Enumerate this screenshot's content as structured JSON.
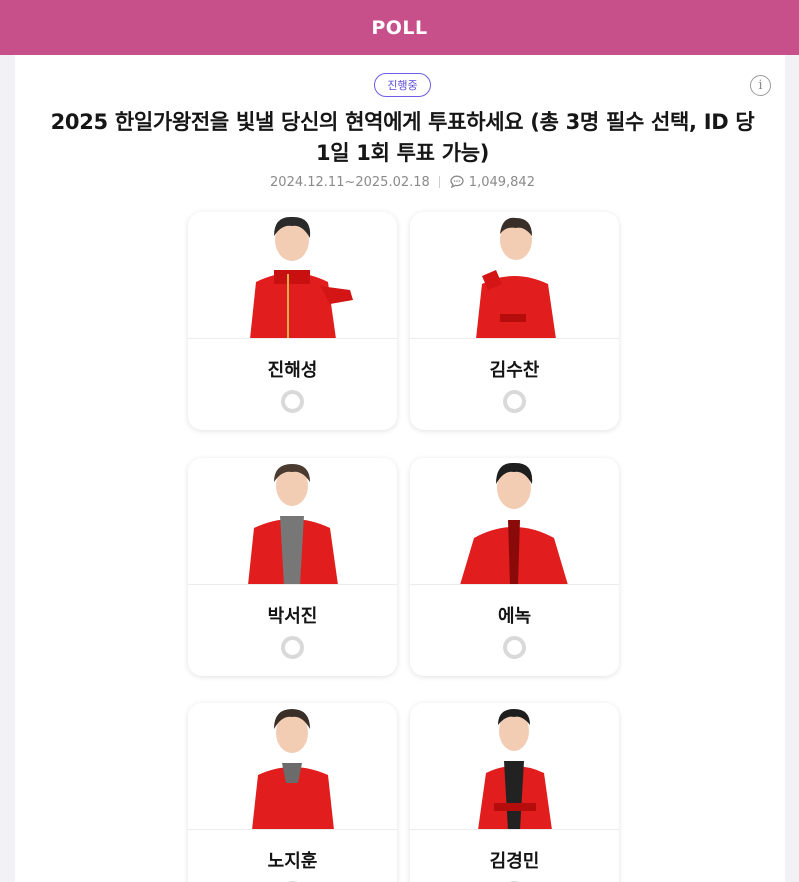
{
  "header": {
    "title": "POLL"
  },
  "poll": {
    "status_badge": "진행중",
    "title": "2025 한일가왕전을 빛낼 당신의 현역에게 투표하세요 (총 3명 필수 선택, ID 당 1일 1회 투표 가능)",
    "period": "2024.12.11~2025.02.18",
    "comment_count": "1,049,842"
  },
  "candidates": [
    {
      "name": "진해성"
    },
    {
      "name": "김수찬"
    },
    {
      "name": "박서진"
    },
    {
      "name": "에녹"
    },
    {
      "name": "노지훈"
    },
    {
      "name": "김경민"
    }
  ],
  "icons": {
    "info": "info-icon",
    "comment": "speech-bubble-icon",
    "radio": "radio-unselected-icon"
  },
  "colors": {
    "header_bg": "#c8508a",
    "badge_accent": "#6c5ce7",
    "costume_red": "#e11d1d"
  }
}
